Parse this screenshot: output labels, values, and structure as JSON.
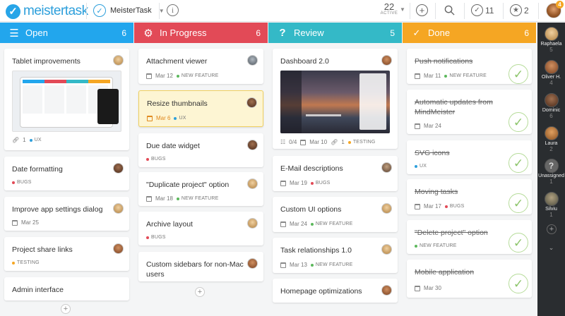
{
  "app": {
    "logo_text": "meistertask",
    "logo_mark": "✓"
  },
  "header": {
    "project_name": "MeisterTask",
    "active_count": "22",
    "active_label": "ACTIVE",
    "checks_count": "11",
    "stars_count": "2",
    "notifications": "4"
  },
  "columns": [
    {
      "name": "Open",
      "count": "6",
      "color": "#22a6ed",
      "icon": "list-icon"
    },
    {
      "name": "In Progress",
      "count": "6",
      "color": "#e24a57",
      "icon": "gear-icon"
    },
    {
      "name": "Review",
      "count": "5",
      "color": "#34b9c7",
      "icon": "question-icon"
    },
    {
      "name": "Done",
      "count": "6",
      "color": "#f5a623",
      "icon": "check-circle-icon"
    }
  ],
  "open": {
    "c1": {
      "title": "Tablet improvements",
      "attachments": "1",
      "tag": "UX"
    },
    "c2": {
      "title": "Date formatting",
      "tag": "BUGS"
    },
    "c3": {
      "title": "Improve app settings dialog",
      "date": "Mar 25"
    },
    "c4": {
      "title": "Project share links",
      "tag": "TESTING"
    },
    "c5": {
      "title": "Admin interface"
    }
  },
  "progress": {
    "c1": {
      "title": "Attachment viewer",
      "date": "Mar 12",
      "tag": "NEW FEATURE"
    },
    "c2": {
      "title": "Resize thumbnails",
      "date": "Mar 6",
      "tag": "UX"
    },
    "c3": {
      "title": "Due date widget",
      "tag": "BUGS"
    },
    "c4": {
      "title": "\"Duplicate project\" option",
      "date": "Mar 18",
      "tag": "NEW FEATURE"
    },
    "c5": {
      "title": "Archive layout",
      "tag": "BUGS"
    },
    "c6": {
      "title": "Custom sidebars for non-Mac users"
    }
  },
  "review": {
    "c1": {
      "title": "Dashboard 2.0",
      "checklist": "0/4",
      "date": "Mar 10",
      "attachments": "1",
      "tag": "TESTING"
    },
    "c2": {
      "title": "E-Mail descriptions",
      "date": "Mar 19",
      "tag": "BUGS"
    },
    "c3": {
      "title": "Custom UI options",
      "date": "Mar 24",
      "tag": "NEW FEATURE"
    },
    "c4": {
      "title": "Task relationships 1.0",
      "date": "Mar 13",
      "tag": "NEW FEATURE"
    },
    "c5": {
      "title": "Homepage optimizations"
    }
  },
  "done": {
    "c1": {
      "title": "Push notifications",
      "date": "Mar 11",
      "tag": "NEW FEATURE"
    },
    "c2": {
      "title": "Automatic updates from MindMeister",
      "date": "Mar 24"
    },
    "c3": {
      "title": "SVG icons",
      "tag": "UX"
    },
    "c4": {
      "title": "Moving tasks",
      "date": "Mar 17",
      "tag": "BUGS"
    },
    "c5": {
      "title": "\"Delete project\" option",
      "tag": "NEW FEATURE"
    },
    "c6": {
      "title": "Mobile application",
      "date": "Mar 30"
    }
  },
  "tag_colors": {
    "UX": "#2d9fdb",
    "BUGS": "#e24a57",
    "TESTING": "#f5a623",
    "NEW FEATURE": "#5cb85c"
  },
  "members": [
    {
      "name": "Raphaela",
      "count": "5"
    },
    {
      "name": "Oliver H.",
      "count": "4"
    },
    {
      "name": "Dominic",
      "count": "6"
    },
    {
      "name": "Laura",
      "count": "2"
    },
    {
      "name": "Unassigned",
      "count": "1"
    },
    {
      "name": "Silviu",
      "count": "1"
    }
  ]
}
